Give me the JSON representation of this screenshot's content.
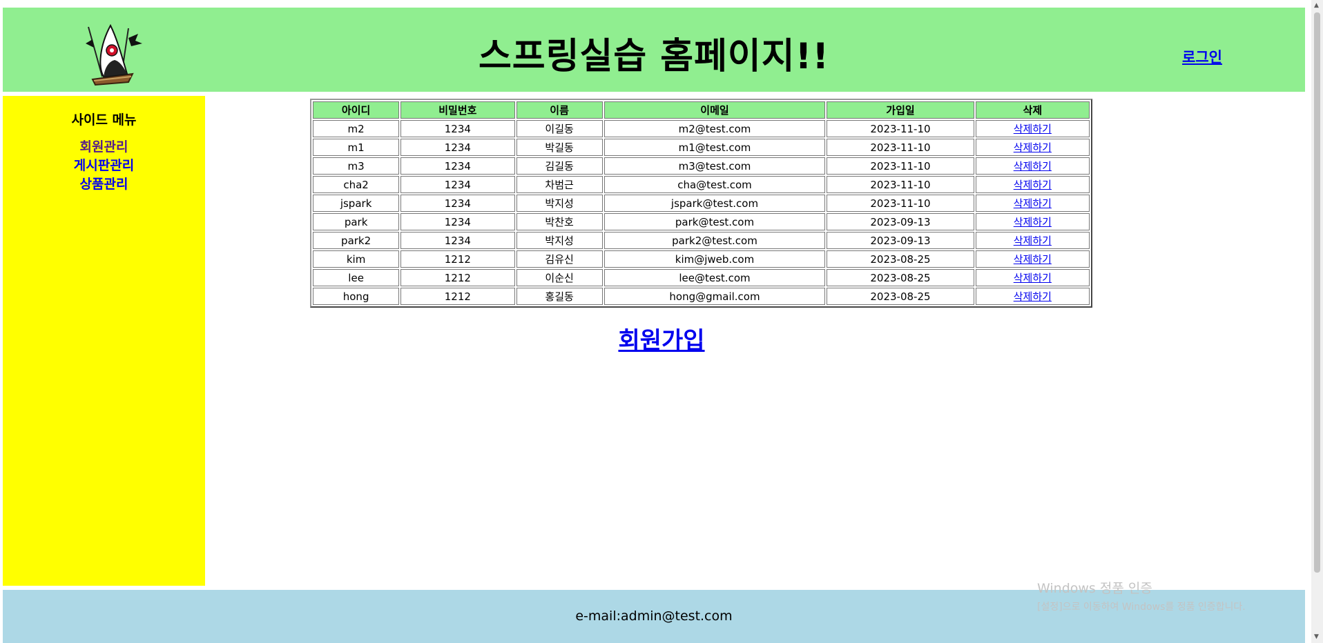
{
  "header": {
    "title": "스프링실습 홈페이지!!",
    "login_label": "로그인",
    "logo_icon": "duke-mascot-icon",
    "bg_color": "#90ee90"
  },
  "sidebar": {
    "title": "사이드 메뉴",
    "bg_color": "#ffff00",
    "items": [
      {
        "label": "회원관리"
      },
      {
        "label": "게시판관리"
      },
      {
        "label": "상품관리"
      }
    ]
  },
  "table": {
    "header_color": "#90ee90",
    "columns": [
      "아이디",
      "비밀번호",
      "이름",
      "이메일",
      "가입일",
      "삭제"
    ],
    "rows": [
      [
        "m2",
        "1234",
        "이길동",
        "m2@test.com",
        "2023-11-10",
        "삭제하기"
      ],
      [
        "m1",
        "1234",
        "박길동",
        "m1@test.com",
        "2023-11-10",
        "삭제하기"
      ],
      [
        "m3",
        "1234",
        "김길동",
        "m3@test.com",
        "2023-11-10",
        "삭제하기"
      ],
      [
        "cha2",
        "1234",
        "차범근",
        "cha@test.com",
        "2023-11-10",
        "삭제하기"
      ],
      [
        "jspark",
        "1234",
        "박지성",
        "jspark@test.com",
        "2023-11-10",
        "삭제하기"
      ],
      [
        "park",
        "1234",
        "박찬호",
        "park@test.com",
        "2023-09-13",
        "삭제하기"
      ],
      [
        "park2",
        "1234",
        "박지성",
        "park2@test.com",
        "2023-09-13",
        "삭제하기"
      ],
      [
        "kim",
        "1212",
        "김유신",
        "kim@jweb.com",
        "2023-08-25",
        "삭제하기"
      ],
      [
        "lee",
        "1212",
        "이순신",
        "lee@test.com",
        "2023-08-25",
        "삭제하기"
      ],
      [
        "hong",
        "1212",
        "홍길동",
        "hong@gmail.com",
        "2023-08-25",
        "삭제하기"
      ]
    ]
  },
  "main": {
    "join_label": "회원가입"
  },
  "footer": {
    "email": "e-mail:admin@test.com",
    "bg_color": "#add8e6"
  },
  "watermark": {
    "title": "Windows 정품 인증",
    "subtitle": "[설정]으로 이동하여 Windows를 정품 인증합니다."
  }
}
